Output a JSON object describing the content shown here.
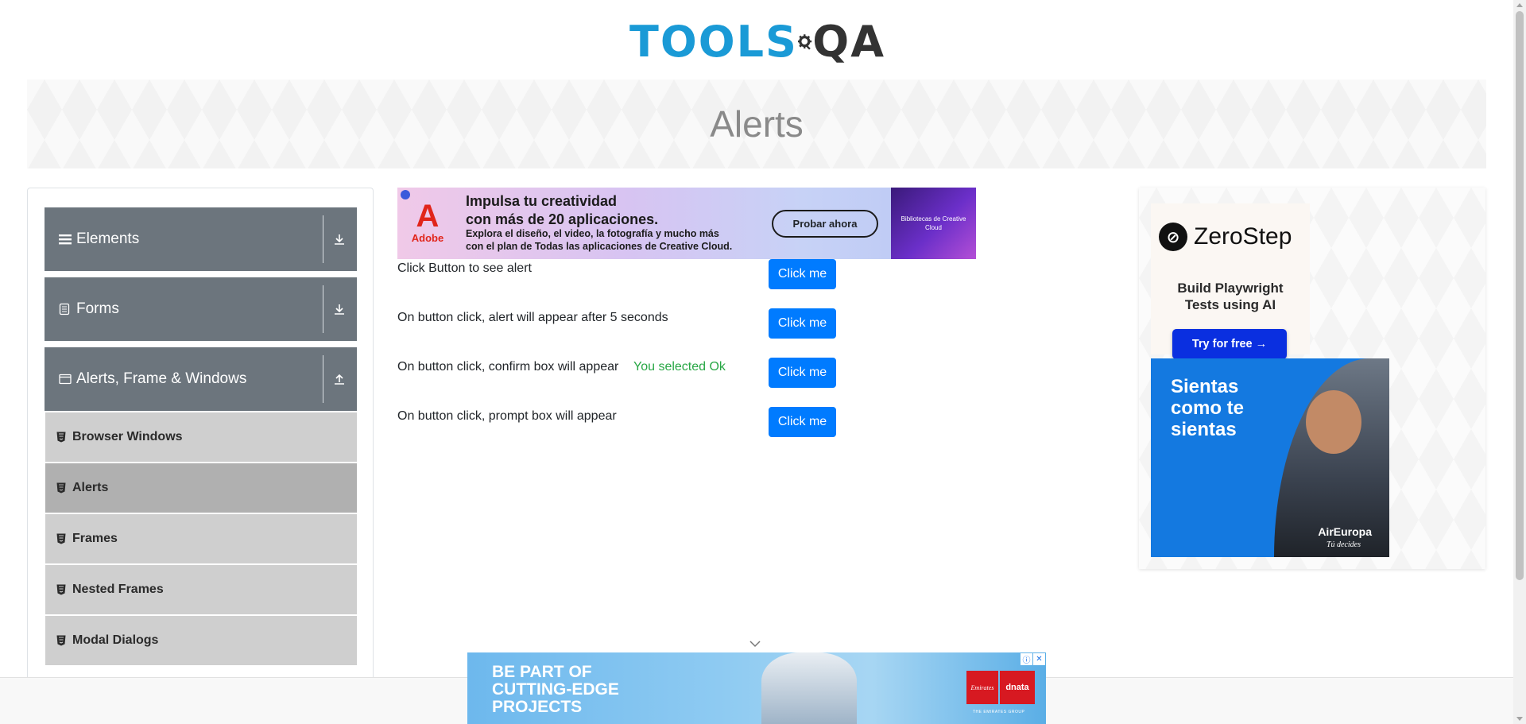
{
  "header": {
    "logo_tools": "TOOLS",
    "logo_qa": "QA"
  },
  "banner": {
    "title": "Alerts"
  },
  "sidebar": {
    "groups": [
      {
        "label": "Elements",
        "icon": "hamburger-icon",
        "state": "collapsed"
      },
      {
        "label": "Forms",
        "icon": "document-icon",
        "state": "collapsed"
      },
      {
        "label": "Alerts, Frame & Windows",
        "icon": "window-icon",
        "state": "expanded"
      }
    ],
    "items": [
      {
        "label": "Browser Windows"
      },
      {
        "label": "Alerts"
      },
      {
        "label": "Frames"
      },
      {
        "label": "Nested Frames"
      },
      {
        "label": "Modal Dialogs"
      }
    ]
  },
  "ad_top": {
    "brand": "Adobe",
    "headline_1": "Impulsa tu creatividad",
    "headline_2": "con más de 20 aplicaciones.",
    "sub_1": "Explora el diseño, el video, la fotografía y mucho más",
    "sub_2": "con el plan de Todas las aplicaciones de Creative Cloud.",
    "cta": "Probar ahora",
    "image_caption": "Bibliotecas de Creative Cloud"
  },
  "alerts": {
    "rows": [
      {
        "label": "Click Button to see alert",
        "button": "Click me"
      },
      {
        "label": "On button click, alert will appear after 5 seconds",
        "button": "Click me"
      },
      {
        "label": "On button click, confirm box will appear",
        "button": "Click me",
        "result": "You selected Ok"
      },
      {
        "label": "On button click, prompt box will appear",
        "button": "Click me"
      }
    ]
  },
  "ad_right": {
    "zerostep_name": "ZeroStep",
    "zerostep_tagline_1": "Build Playwright",
    "zerostep_tagline_2": "Tests using AI",
    "zerostep_cta": "Try for free →",
    "aireuropa_text_1": "Sientas",
    "aireuropa_text_2": "como te",
    "aireuropa_text_3": "sientas",
    "aireuropa_brand": "AirEuropa",
    "aireuropa_slogan": "Tú decides"
  },
  "ad_bottom": {
    "line_1": "BE PART OF",
    "line_2": "CUTTING-EDGE",
    "line_3": "PROJECTS",
    "emirates": "Emirates",
    "dnata": "dnata",
    "group": "THE EMIRATES GROUP"
  },
  "colors": {
    "primary_button": "#007bff",
    "success_text": "#28a745",
    "sidebar_header": "#6c757d",
    "sidebar_item": "#cfcfcf",
    "sidebar_item_active": "#b0b0b0",
    "logo_blue": "#1a9ad6"
  }
}
